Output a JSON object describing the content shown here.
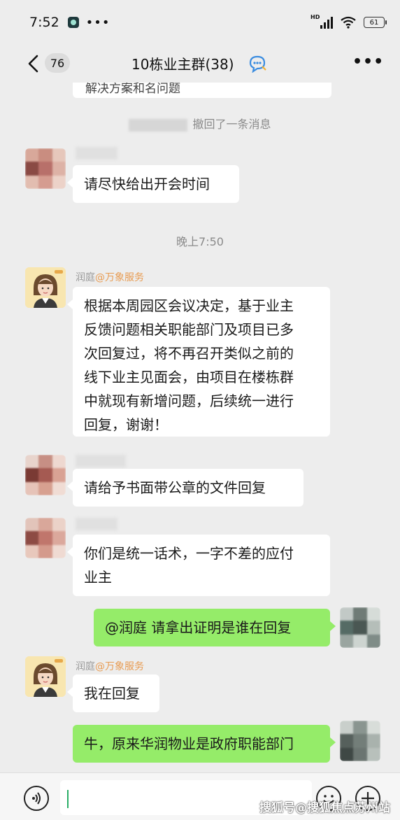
{
  "status_bar": {
    "time": "7:52",
    "dots": "•••",
    "network_label": "HD",
    "battery": "61"
  },
  "header": {
    "back_count": "76",
    "title": "10栋业主群(38)",
    "more": "•••"
  },
  "messages": {
    "clipped_text": "解决方案和名问题",
    "recall_notice": "撤回了一条消息",
    "time_divider": "晚上7:50",
    "m1_text": "请尽快给出开会时间",
    "m2_sender": "润庭",
    "m2_org": "@万象服务",
    "m2_lines": [
      "根据本周园区会议决定，基于业主",
      "反馈问题相关职能部门及项目已多",
      "次回复过，将不再召开类似之前的",
      "线下业主见面会，由项目在楼栋群",
      "中就现有新增问题，后续统一进行",
      "回复，谢谢！"
    ],
    "m3_text": "请给予书面带公章的文件回复",
    "m4_lines": [
      "你们是统一话术，一字不差的应付",
      "业主"
    ],
    "m5_text": "@润庭  请拿出证明是谁在回复",
    "m6_sender": "润庭",
    "m6_org": "@万象服务",
    "m6_text": "我在回复",
    "m7_text": "牛，原来华润物业是政府职能部门"
  },
  "watermark": "搜狐号@搜狐焦点苏州站",
  "colors": {
    "background": "#ededed",
    "sent_bubble": "#95ec69",
    "received_bubble": "#ffffff",
    "org_tag": "#e89c53"
  }
}
